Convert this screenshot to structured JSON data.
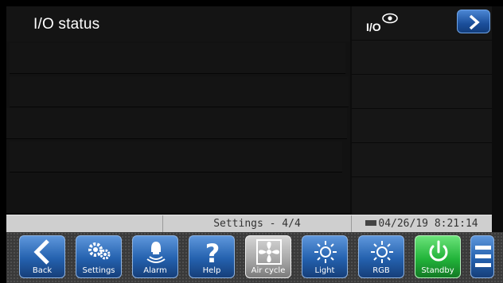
{
  "header": {
    "title": "I/O status"
  },
  "side_panel": {
    "io_label": "I/O",
    "io_icon": "eye-icon",
    "next_icon": "chevron-right-icon"
  },
  "status_bar": {
    "page_info": "Settings - 4/4",
    "datetime": "04/26/19 8:21:14"
  },
  "toolbar": {
    "back": "Back",
    "settings": "Settings",
    "alarm": "Alarm",
    "help": "Help",
    "air_cycle": "Air cycle",
    "light": "Light",
    "rgb": "RGB",
    "standby": "Standby"
  },
  "colors": {
    "button_blue": "#2461ae",
    "standby_green": "#22b43a",
    "air_cycle_gray": "#a9a9a9"
  }
}
